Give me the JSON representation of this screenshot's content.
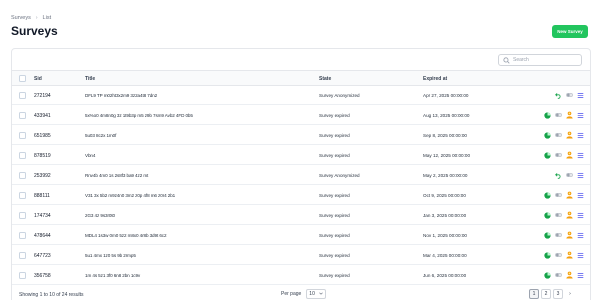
{
  "breadcrumb": {
    "root": "Surveys",
    "current": "List"
  },
  "page_title": "Surveys",
  "new_button": "New Survey",
  "search": {
    "placeholder": "Search"
  },
  "columns": {
    "sid": "Sid",
    "title": "Title",
    "state": "State",
    "expired": "Expired at"
  },
  "rows": [
    {
      "sid": "272194",
      "title": "DFL9 TP m02ht3x2m9 3z2a4t8 7dn2",
      "state": "Survey Anonymized",
      "expired": "Apr 27, 2025 00:00:00",
      "actions": [
        "undo-icon",
        "toggle-icon",
        "list-icon"
      ]
    },
    {
      "sid": "433941",
      "title": "5x%o0 4m8n0g 3z 1t9b3p m5 z9b 7sm9 Avb2 4FD 0b5",
      "state": "Survey expired",
      "expired": "Aug 13, 2025 00:00:00",
      "actions": [
        "stats-icon",
        "toggle-icon",
        "user-icon",
        "list-icon"
      ]
    },
    {
      "sid": "651985",
      "title": "5u03 8c2x 1m0f",
      "state": "Survey expired",
      "expired": "Sep 8, 2025 00:00:00",
      "actions": [
        "stats-icon",
        "toggle-icon",
        "user-icon",
        "list-icon"
      ]
    },
    {
      "sid": "878519",
      "title": "Vbn4",
      "state": "Survey expired",
      "expired": "May 12, 2025 00:00:00",
      "actions": [
        "stats-icon",
        "toggle-icon",
        "user-icon",
        "list-icon"
      ]
    },
    {
      "sid": "253992",
      "title": "Rnv4b 4m0 1s 2s8f3 ba9 4z2 mt",
      "state": "Survey Anonymized",
      "expired": "May 2, 2025 00:00:00",
      "actions": [
        "undo-icon",
        "toggle-icon",
        "list-icon"
      ]
    },
    {
      "sid": "888111",
      "title": "V31 3x 5b2 m9z4n0 3m2 z0p 4f8 m6 z0r4 2b1",
      "state": "Survey expired",
      "expired": "Oct 9, 2025 00:00:00",
      "actions": [
        "stats-icon",
        "toggle-icon",
        "user-icon",
        "list-icon"
      ]
    },
    {
      "sid": "174734",
      "title": "2G3 4z 9s3r0t0",
      "state": "Survey expired",
      "expired": "Jan 3, 2025 00:00:00",
      "actions": [
        "stats-icon",
        "toggle-icon",
        "user-icon",
        "list-icon"
      ]
    },
    {
      "sid": "478644",
      "title": "MDL4 1s3w 0m0 5z2 m8x0 4r8b 3d9t 6c2",
      "state": "Survey expired",
      "expired": "Nov 1, 2025 00:00:00",
      "actions": [
        "stats-icon",
        "toggle-icon",
        "user-icon",
        "list-icon"
      ]
    },
    {
      "sid": "647723",
      "title": "5u1 4mx 1z0 5s 9b 2rmp5",
      "state": "Survey expired",
      "expired": "Mar 4, 2025 00:00:00",
      "actions": [
        "stats-icon",
        "toggle-icon",
        "user-icon",
        "list-icon"
      ]
    },
    {
      "sid": "356758",
      "title": "1m 4s 5z1 3f0 6n8 2bn 1c9v",
      "state": "Survey expired",
      "expired": "Jun 6, 2025 00:00:00",
      "actions": [
        "stats-icon",
        "toggle-icon",
        "user-icon",
        "list-icon"
      ]
    }
  ],
  "footer": {
    "summary": "Showing 1 to 10 of 24 results",
    "per_page_label": "Per page",
    "per_page_value": "10",
    "pages": [
      "1",
      "2",
      "3"
    ],
    "next": "›"
  },
  "colors": {
    "accent": "#22c55e",
    "border": "#e5e7eb",
    "header_bg": "#f9fafb",
    "icon_green": "#16a34a",
    "icon_orange": "#f59e0b",
    "icon_blue": "#6366f1"
  }
}
